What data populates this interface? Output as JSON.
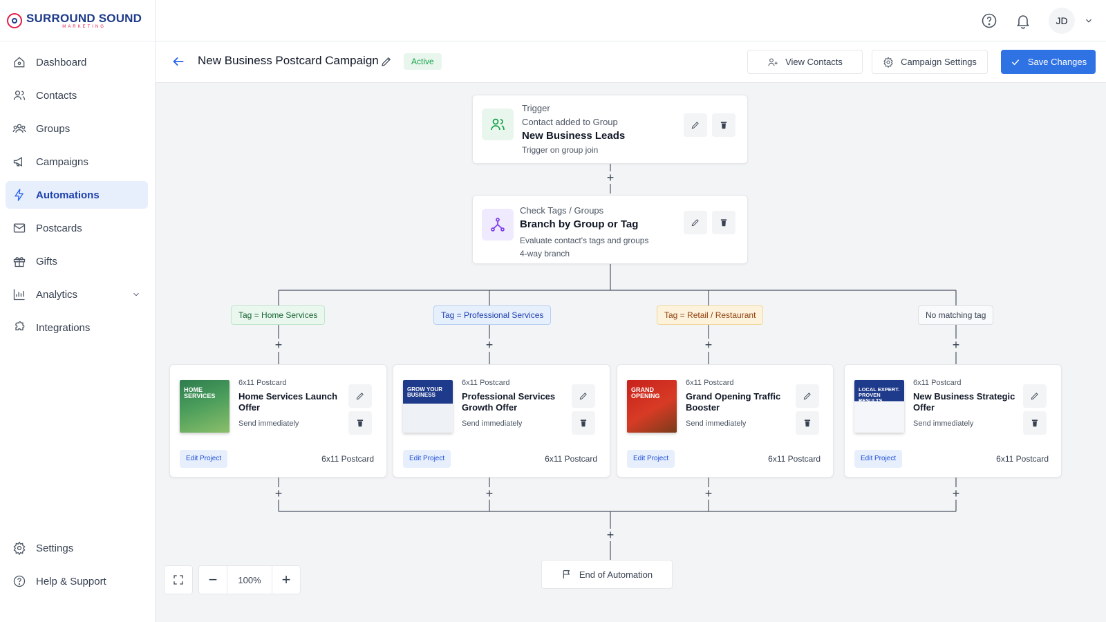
{
  "brand": {
    "name": "SURROUND SOUND",
    "tagline": "MARKETING"
  },
  "sidebar": {
    "items": [
      {
        "label": "Dashboard",
        "icon": "home-icon"
      },
      {
        "label": "Contacts",
        "icon": "users-icon"
      },
      {
        "label": "Groups",
        "icon": "group-icon"
      },
      {
        "label": "Campaigns",
        "icon": "megaphone-icon"
      },
      {
        "label": "Automations",
        "icon": "bolt-icon",
        "active": true
      },
      {
        "label": "Postcards",
        "icon": "mail-icon"
      },
      {
        "label": "Gifts",
        "icon": "gift-icon"
      },
      {
        "label": "Analytics",
        "icon": "bar-chart-icon",
        "expandable": true
      },
      {
        "label": "Integrations",
        "icon": "puzzle-icon"
      }
    ],
    "bottom": [
      {
        "label": "Settings",
        "icon": "gear-icon"
      },
      {
        "label": "Help & Support",
        "icon": "help-circle-icon"
      }
    ]
  },
  "topbar": {
    "avatar_initials": "JD"
  },
  "header": {
    "title": "New Business Postcard Campaign",
    "status": "Active",
    "view_contacts": "View Contacts",
    "campaign_settings": "Campaign Settings",
    "save": "Save Changes"
  },
  "flow": {
    "trigger": {
      "kicker": "Trigger",
      "event": "Contact added to Group",
      "group": "New Business Leads",
      "note": "Trigger on group join"
    },
    "branch": {
      "kicker": "Check Tags / Groups",
      "title": "Branch by Group or Tag",
      "description": "Evaluate contact's tags and groups",
      "ways": "4-way branch"
    },
    "branches": [
      {
        "condition": "Tag = Home Services",
        "kind": "6x11 Postcard",
        "name": "Home Services Launch Offer",
        "send": "Send immediately",
        "edit": "Edit Project",
        "format": "6x11 Postcard",
        "thumb_text": "HOME SERVICES"
      },
      {
        "condition": "Tag = Professional Services",
        "kind": "6x11 Postcard",
        "name": "Professional Services Growth Offer",
        "send": "Send immediately",
        "edit": "Edit Project",
        "format": "6x11 Postcard",
        "thumb_text": "GROW YOUR BUSINESS"
      },
      {
        "condition": "Tag = Retail / Restaurant",
        "kind": "6x11 Postcard",
        "name": "Grand Opening Traffic Booster",
        "send": "Send immediately",
        "edit": "Edit Project",
        "format": "6x11 Postcard",
        "thumb_text": "GRAND OPENING"
      },
      {
        "condition": "No matching tag",
        "kind": "6x11 Postcard",
        "name": "New Business Strategic Offer",
        "send": "Send immediately",
        "edit": "Edit Project",
        "format": "6x11 Postcard",
        "thumb_text": "LOCAL EXPERT. PROVEN RESULTS."
      }
    ],
    "end": "End of Automation"
  },
  "zoom": {
    "level": "100%"
  },
  "colors": {
    "accent": "#2f72e4",
    "active_status": "#16a34a",
    "trigger_icon_bg": "#e8f6ed",
    "branch_icon_bg": "#efeafd"
  }
}
